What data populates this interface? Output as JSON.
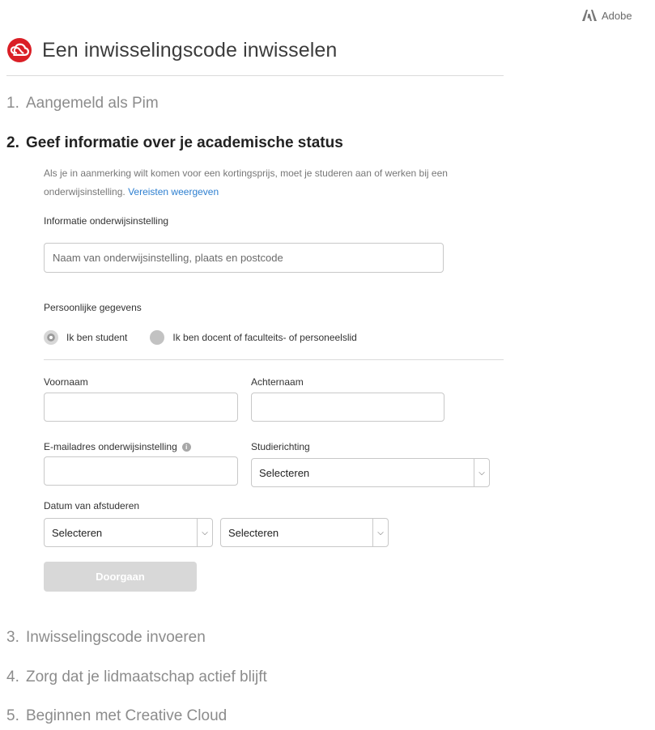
{
  "brand": {
    "name": "Adobe"
  },
  "page": {
    "title": "Een inwisselingscode inwisselen"
  },
  "steps": [
    {
      "num": "1.",
      "label": "Aangemeld als Pim"
    },
    {
      "num": "2.",
      "label": "Geef informatie over je academische status"
    },
    {
      "num": "3.",
      "label": "Inwisselingscode invoeren"
    },
    {
      "num": "4.",
      "label": "Zorg dat je lidmaatschap actief blijft"
    },
    {
      "num": "5.",
      "label": "Beginnen met Creative Cloud"
    }
  ],
  "academic": {
    "description": "Als je in aanmerking wilt komen voor een kortingsprijs, moet je studeren aan of werken bij een onderwijsinstelling.",
    "requirements_link": "Vereisten weergeven",
    "institution_label": "Informatie onderwijsinstelling",
    "institution_placeholder": "Naam van onderwijsinstelling, plaats en postcode",
    "personal_label": "Persoonlijke gegevens",
    "radio_student": "Ik ben student",
    "radio_teacher": "Ik ben docent of faculteits- of personeelslid",
    "first_name_label": "Voornaam",
    "last_name_label": "Achternaam",
    "email_label": "E-mailadres onderwijsinstelling",
    "study_label": "Studierichting",
    "study_value": "Selecteren",
    "graduation_label": "Datum van afstuderen",
    "graduation_month": "Selecteren",
    "graduation_year": "Selecteren",
    "continue_label": "Doorgaan"
  },
  "colors": {
    "link": "#2d7fd0",
    "brand_red": "#da1f26",
    "disabled_button": "#d8d8d8"
  }
}
